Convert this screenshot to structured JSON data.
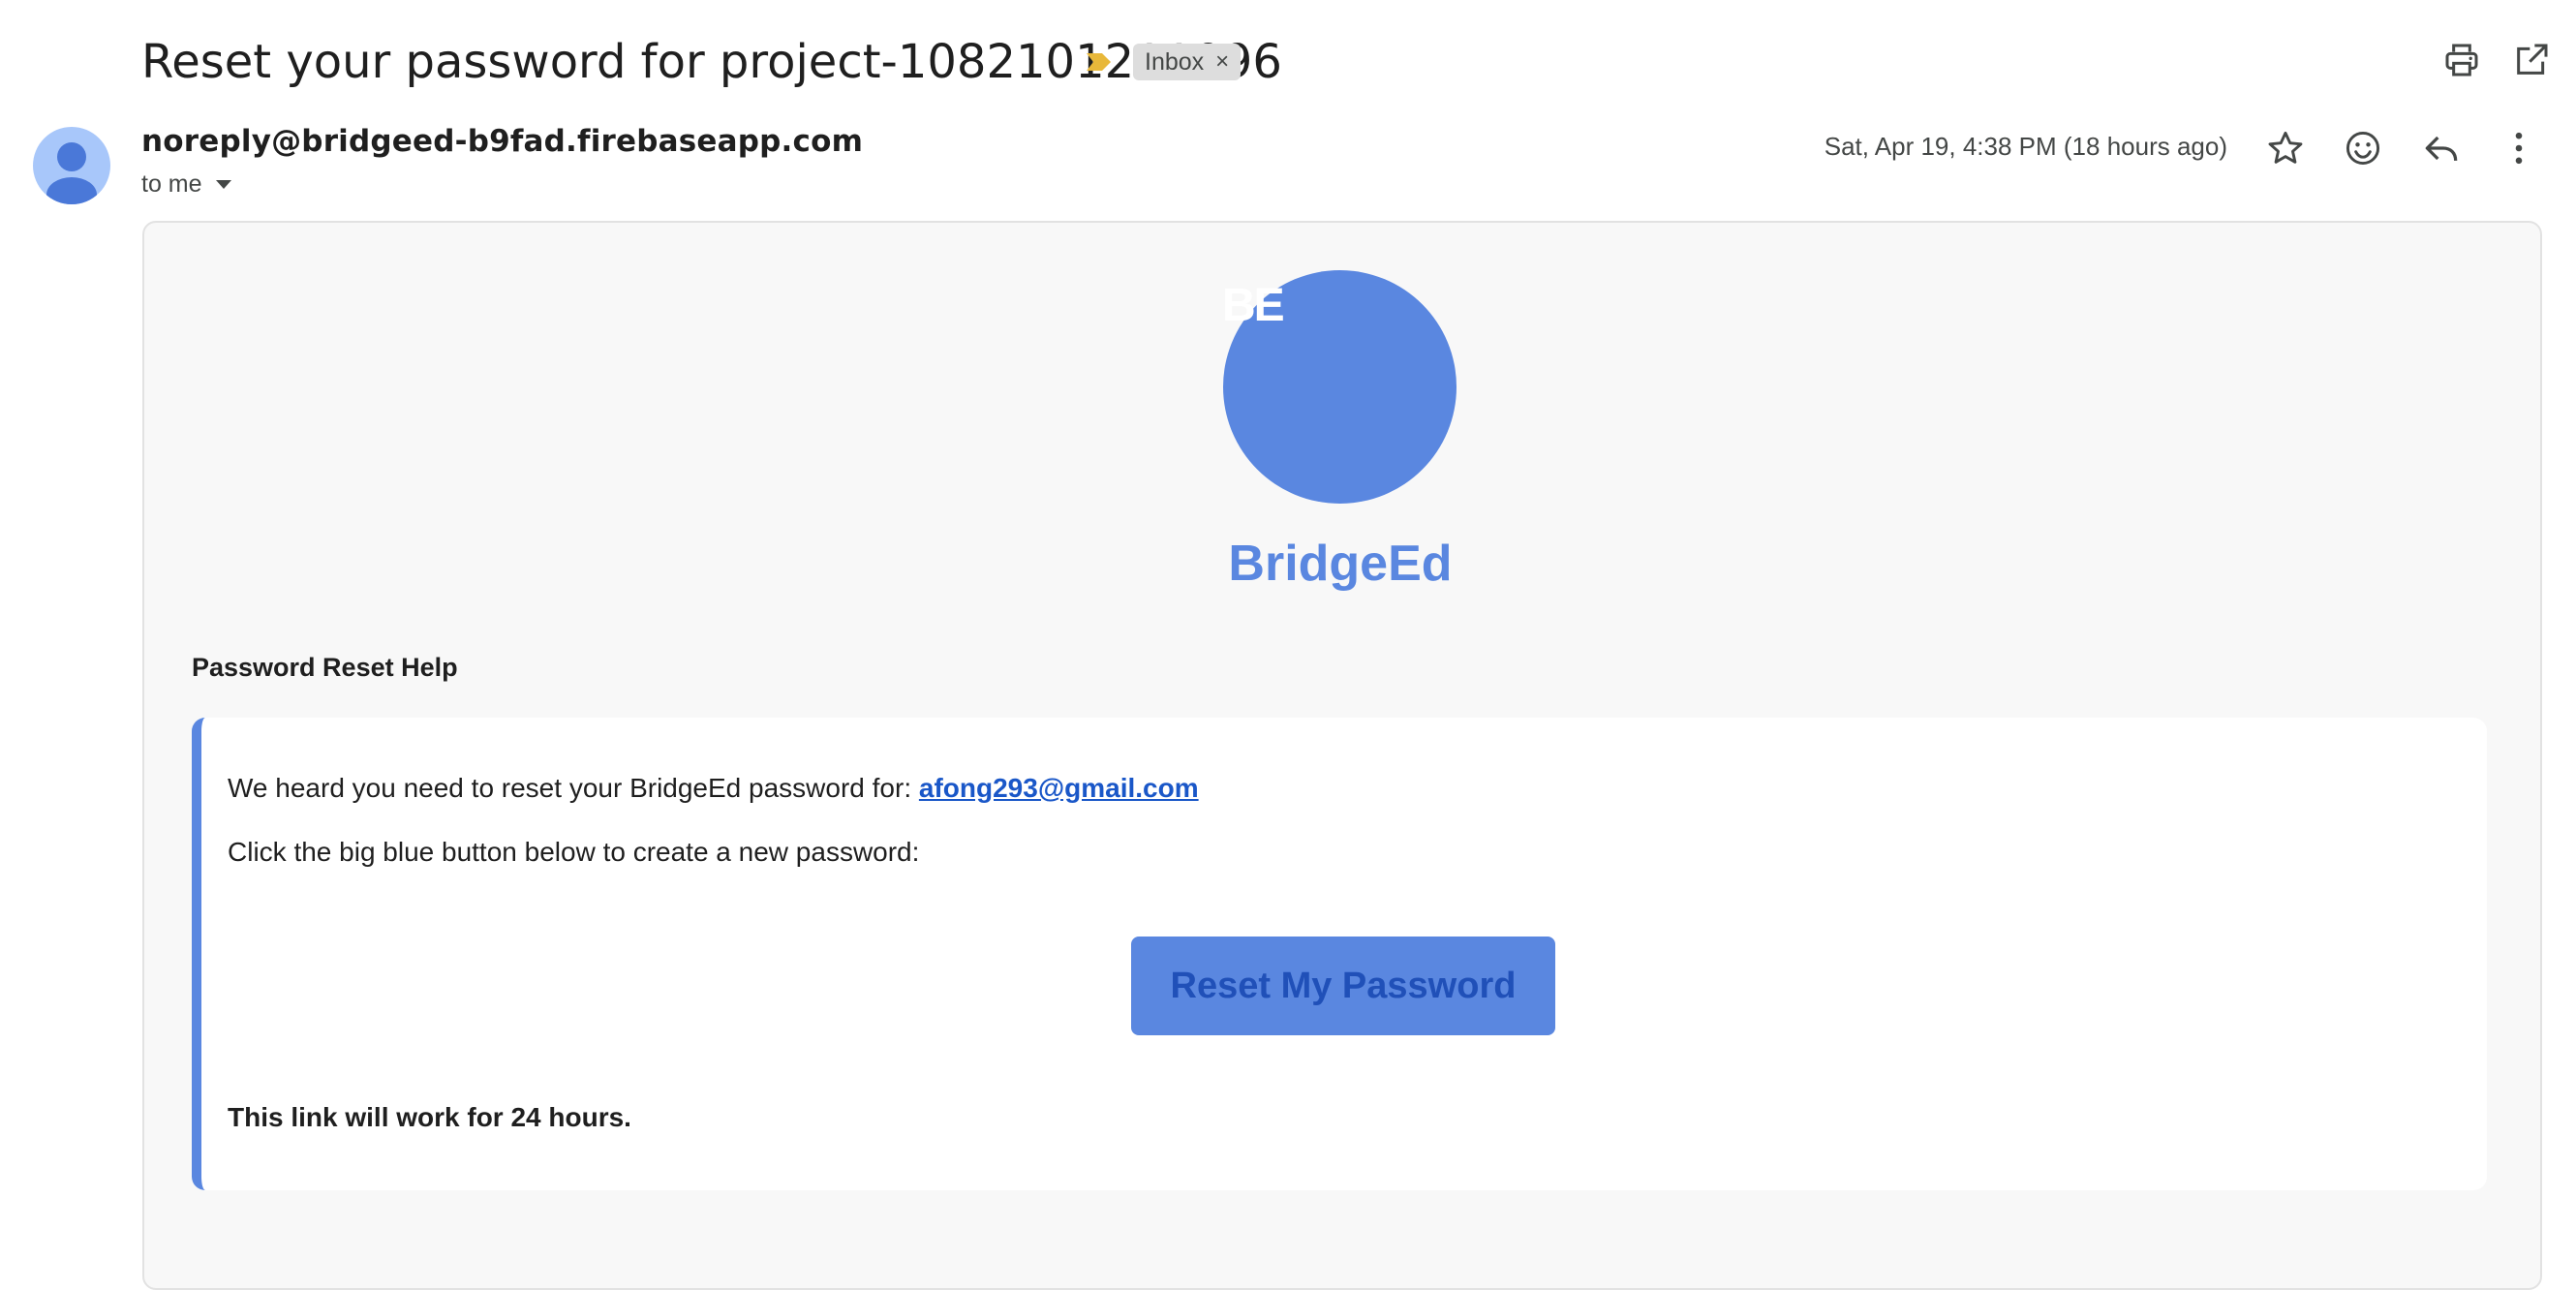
{
  "email": {
    "subject": "Reset your password for project-1082101211096",
    "label_chip": "Inbox",
    "label_chip_close": "×",
    "sender": "noreply@bridgeed-b9fad.firebaseapp.com",
    "recipient": "to me",
    "date": "Sat, Apr 19, 4:38 PM (18 hours ago)"
  },
  "icons": {
    "importance": "importance-marker-icon",
    "print": "print-icon",
    "open_new_window": "open-in-new-window-icon",
    "star": "star-icon",
    "emoji": "emoji-reaction-icon",
    "reply": "reply-icon",
    "more": "more-vert-icon",
    "avatar": "default-avatar-icon",
    "dropdown": "caret-down-icon"
  },
  "body": {
    "logo_initials": "BE",
    "brand_name": "BridgeEd",
    "heading": "Password Reset Help",
    "intro_text": "We heard you need to reset your BridgeEd password for: ",
    "account_email": "afong293@gmail.com",
    "instruction": "Click the big blue button below to create a new password:",
    "button_label": "Reset My Password",
    "expiry_note": "This link will work for 24 hours."
  },
  "colors": {
    "brand_blue": "#5a87e0",
    "button_text": "#2050b8",
    "link": "#1a57c8",
    "importance": "#e8b83a",
    "chip_bg": "#dddddd",
    "avatar_bg": "#a8c7fa",
    "avatar_fg": "#4a78d8"
  }
}
